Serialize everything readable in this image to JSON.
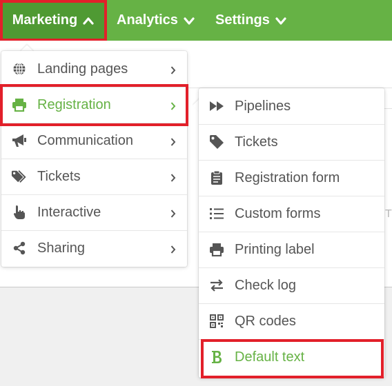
{
  "topnav": {
    "items": [
      {
        "label": "Marketing",
        "chevron": "chevron-up-icon"
      },
      {
        "label": "Analytics",
        "chevron": "chevron-down-icon"
      },
      {
        "label": "Settings",
        "chevron": "chevron-down-icon"
      }
    ]
  },
  "marketing_menu": {
    "items": [
      {
        "label": "Landing pages",
        "icon": "globe-icon"
      },
      {
        "label": "Registration",
        "icon": "printer-icon",
        "active": true
      },
      {
        "label": "Communication",
        "icon": "megaphone-icon"
      },
      {
        "label": "Tickets",
        "icon": "tags-icon"
      },
      {
        "label": "Interactive",
        "icon": "pointer-hand-icon"
      },
      {
        "label": "Sharing",
        "icon": "share-icon"
      }
    ]
  },
  "registration_menu": {
    "items": [
      {
        "label": "Pipelines",
        "icon": "fast-forward-icon"
      },
      {
        "label": "Tickets",
        "icon": "tag-icon"
      },
      {
        "label": "Registration form",
        "icon": "clipboard-icon"
      },
      {
        "label": "Custom forms",
        "icon": "list-icon"
      },
      {
        "label": "Printing label",
        "icon": "printer-icon"
      },
      {
        "label": "Check log",
        "icon": "exchange-icon"
      },
      {
        "label": "QR codes",
        "icon": "qrcode-icon"
      },
      {
        "label": "Default text",
        "icon": "bold-icon",
        "active": true
      }
    ]
  },
  "page": {
    "faint_letter": "T"
  },
  "colors": {
    "brand": "#66b245",
    "brand_dark": "#4f9a33",
    "highlight": "#e2202a",
    "text": "#555555"
  }
}
